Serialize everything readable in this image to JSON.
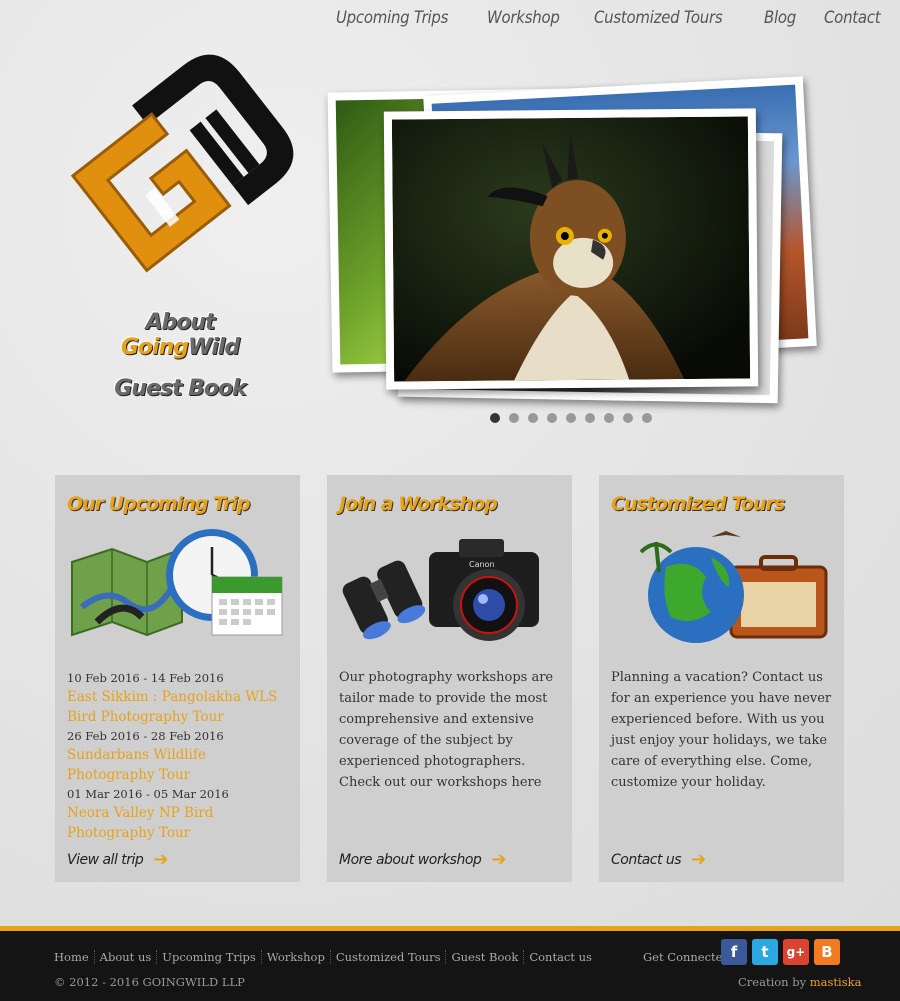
{
  "nav": {
    "items": [
      "Upcoming Trips",
      "Workshop",
      "Customized Tours",
      "Blog",
      "Contact"
    ]
  },
  "sidebar": {
    "about_prefix": "About ",
    "about_going": "Going",
    "about_wild": "Wild",
    "guestbook": "Guest Book"
  },
  "slider": {
    "slide_count": 9,
    "active_index": 0
  },
  "panels": {
    "trips": {
      "title": "Our Upcoming Trip",
      "items": [
        {
          "date": "10 Feb 2016 - 14 Feb 2016",
          "name": "East Sikkim : Pangolakha WLS Bird Photography Tour"
        },
        {
          "date": "26 Feb 2016 - 28 Feb 2016",
          "name": "Sundarbans Wildlife Photography Tour"
        },
        {
          "date": "01 Mar 2016 - 05 Mar 2016",
          "name": "Neora Valley NP Bird Photography Tour"
        }
      ],
      "more": "View all trip"
    },
    "workshop": {
      "title": "Join a Workshop",
      "text": "Our photography workshops are tailor made to provide the most comprehensive and extensive coverage of the subject by experienced photographers. Check out our workshops here",
      "more": "More about workshop"
    },
    "tours": {
      "title": "Customized Tours",
      "text": "Planning a vacation? Contact us for an experience you have never experienced before. With us you just enjoy your holidays, we take care of everything else. Come, customize your holiday.",
      "more": "Contact us"
    }
  },
  "footer": {
    "links": [
      "Home",
      "About us",
      "Upcoming Trips",
      "Workshop",
      "Customized Tours",
      "Guest Book",
      "Contact us"
    ],
    "copyright": "© 2012 - 2016 GOINGWILD LLP",
    "connect": "Get Connected:",
    "credit_prefix": "Creation by ",
    "credit_name": "mastiska",
    "social": [
      "f",
      "t",
      "g+",
      "B"
    ]
  },
  "colors": {
    "accent": "#e8a21a",
    "panel": "#cfcfcf",
    "footer": "#141414"
  }
}
